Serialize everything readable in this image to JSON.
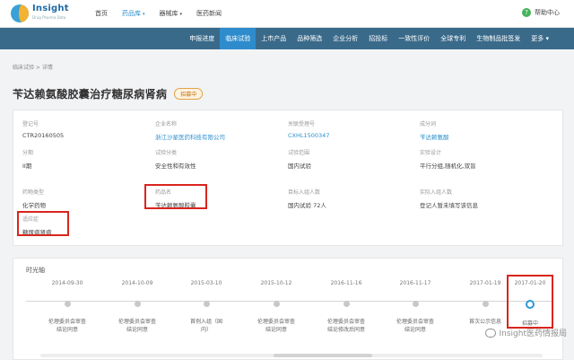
{
  "logo": {
    "title": "Insight",
    "sub": "Drug Pharma Data"
  },
  "topnav": {
    "items": [
      "首页",
      "药品库",
      "器械库",
      "医药新闻"
    ],
    "caret": "▾"
  },
  "help": {
    "icon": "?",
    "label": "帮助中心"
  },
  "mainnav": {
    "items": [
      "申报进度",
      "临床试验",
      "上市产品",
      "品种筛选",
      "企业分析",
      "招投标",
      "一致性评价",
      "全球专利",
      "生物制品批签发",
      "更多 ▾"
    ]
  },
  "breadcrumb": "临床试验 > 详情",
  "page": {
    "title": "苄达赖氨酸胶囊治疗糖尿病肾病",
    "status": "招募中"
  },
  "fields": {
    "reg_no": {
      "label": "登记号",
      "value": "CTR20160505"
    },
    "sponsor": {
      "label": "企业名称",
      "value": "浙江沙星医药科技有限公司"
    },
    "accept_no": {
      "label": "关联受理号",
      "value": "CXHL1500347"
    },
    "ingredient": {
      "label": "成分词",
      "value": "苄达赖氨酸"
    },
    "phase": {
      "label": "分期",
      "value": "II期"
    },
    "purpose": {
      "label": "试验分类",
      "value": "安全性和有效性"
    },
    "scope": {
      "label": "试验范围",
      "value": "国内试验"
    },
    "design": {
      "label": "实验设计",
      "value": "平行分组,随机化,双盲"
    },
    "drug_type": {
      "label": "药物类型",
      "value": "化学药物"
    },
    "drug_name": {
      "label": "药品名",
      "value": "苄达赖氨酸胶囊"
    },
    "enrollment": {
      "label": "目标入组人数",
      "value": "国内试验 72人"
    },
    "actual_enroll": {
      "label": "实际入组人数",
      "value": "登记人暂未填写该信息"
    },
    "indication": {
      "label": "适应症",
      "value": "糖尿病肾病"
    }
  },
  "timeline": {
    "title": "时光轴",
    "nodes": [
      {
        "date": "2014-09-30",
        "line1": "伦理委员会审查",
        "line2": "结论同意"
      },
      {
        "date": "2014-10-09",
        "line1": "伦理委员会审查",
        "line2": "结论同意"
      },
      {
        "date": "2015-03-10",
        "line1": "首例入组（国",
        "line2": "内）"
      },
      {
        "date": "2015-10-12",
        "line1": "伦理委员会审查",
        "line2": "结论同意"
      },
      {
        "date": "2016-11-16",
        "line1": "伦理委员会审查",
        "line2": "结论修改后同意"
      },
      {
        "date": "2016-11-17",
        "line1": "伦理委员会审查",
        "line2": "结论同意"
      },
      {
        "date": "2017-01-19",
        "line1": "首次公示信息",
        "line2": ""
      },
      {
        "date": "2017-01-20",
        "line1": "招募中",
        "line2": ""
      }
    ]
  },
  "watermark": "Insight医药情报局",
  "colors": {
    "accent": "#2c8fce",
    "nav_bg": "#3a6a8a",
    "highlight": "#d9251d"
  }
}
